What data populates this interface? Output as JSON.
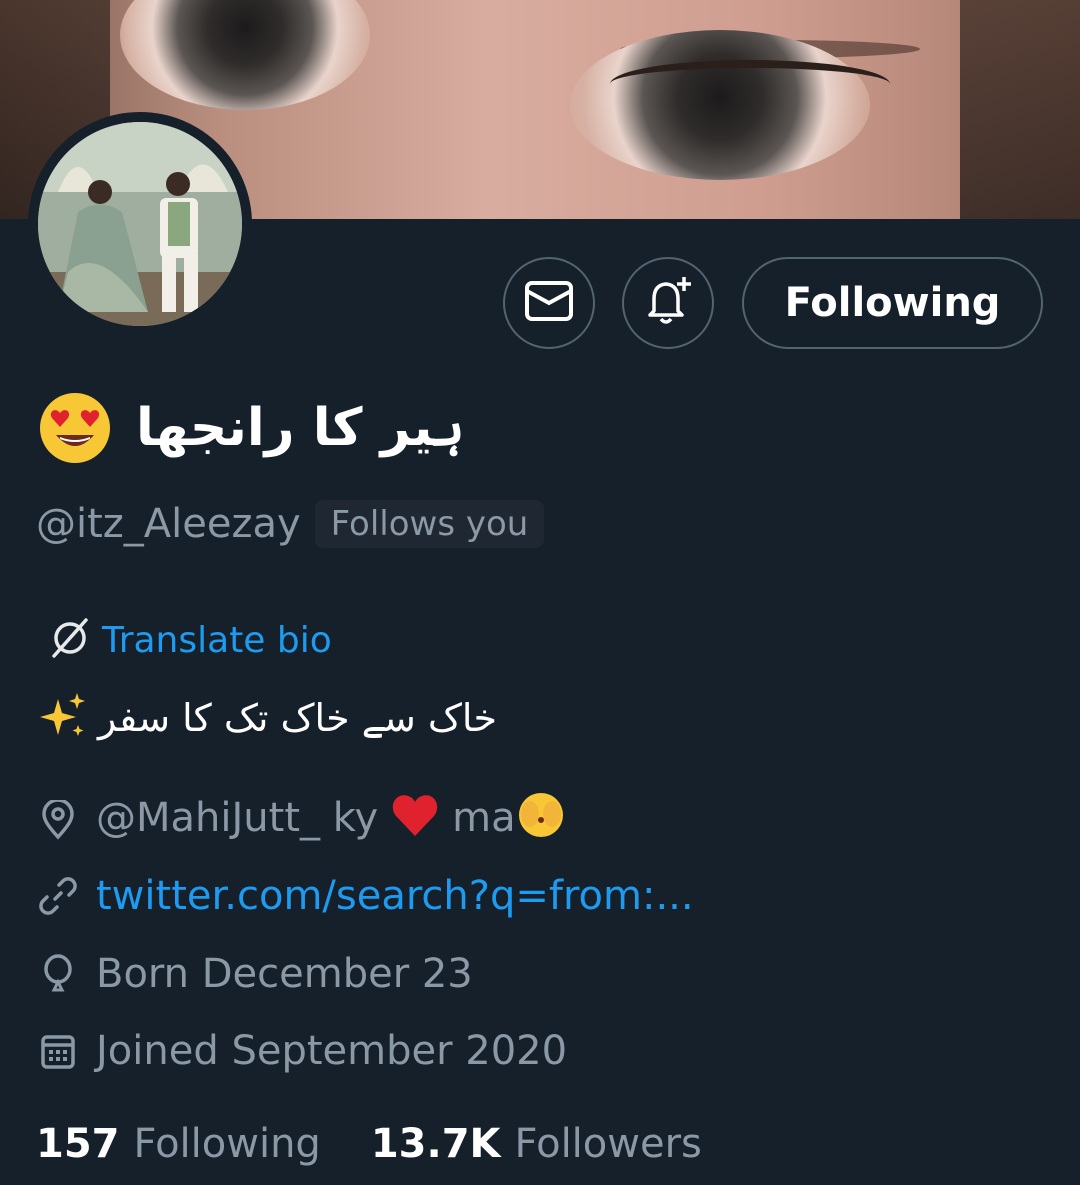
{
  "profile": {
    "display_name": "ہیر کا رانجھا",
    "name_emoji": "smiling-face-heart-eyes",
    "handle": "@itz_Aleezay",
    "follows_you_badge": "Follows you",
    "translate_label": "Translate bio",
    "bio": "خاک سے خاک تک کا سفر",
    "bio_emoji": "sparkles",
    "location_prefix": "@MahiJutt_ ky",
    "location_suffix": "ma",
    "website": "twitter.com/search?q=from:...",
    "birthday": "Born December 23",
    "joined": "Joined September 2020"
  },
  "actions": {
    "message_icon": "envelope-icon",
    "notify_icon": "bell-plus-icon",
    "follow_label": "Following"
  },
  "stats": {
    "following_count": "157",
    "following_label": "Following",
    "followers_count": "13.7K",
    "followers_label": "Followers"
  },
  "colors": {
    "background": "#15202b",
    "accent": "#1d9bf0",
    "secondary_text": "#8b98a5",
    "border": "#536471"
  }
}
